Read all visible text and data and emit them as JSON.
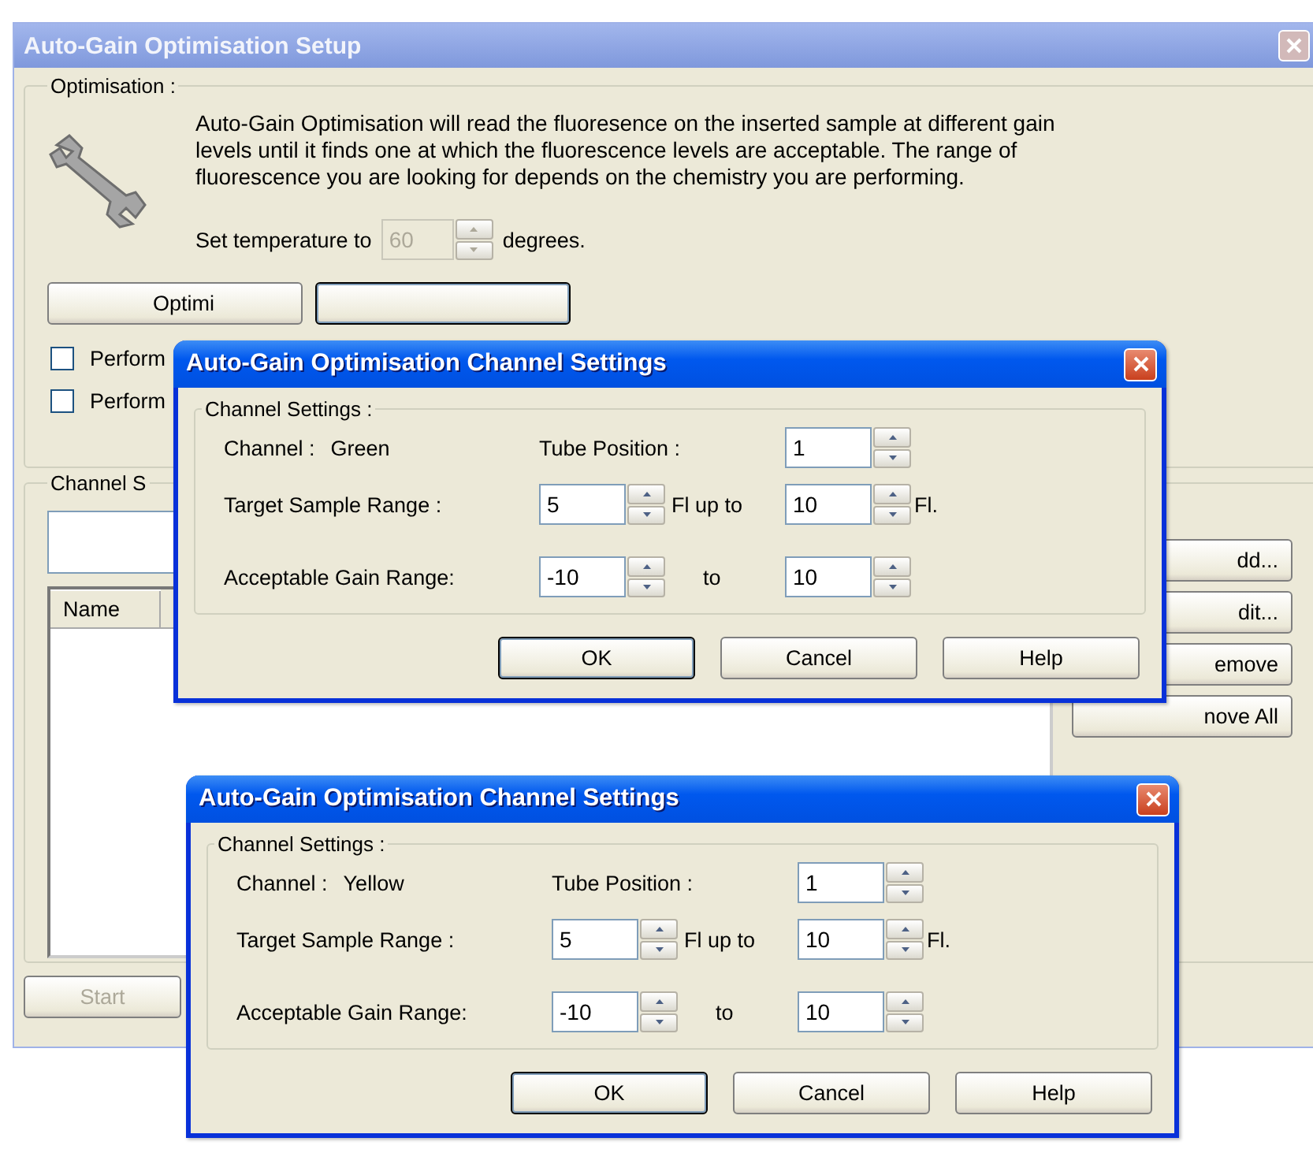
{
  "setup_window": {
    "title": "Auto-Gain Optimisation Setup",
    "optimisation": {
      "legend": "Optimisation :",
      "description": "Auto-Gain Optimisation will read the fluoresence on the inserted sample at different gain levels until it finds one at which the fluorescence levels are acceptable. The range of fluorescence you are looking for depends on the chemistry you are performing.",
      "temperature_label": "Set temperature to",
      "temperature": {
        "value": "60",
        "disabled": true
      },
      "temperature_unit": "degrees.",
      "buttons": [
        {
          "label": "Optimi"
        }
      ],
      "checkboxes": [
        {
          "label": "Perform",
          "checked": false
        },
        {
          "label": "Perform",
          "checked": false
        }
      ]
    },
    "channels": {
      "legend": "Channel S",
      "list_columns": [
        "Name"
      ],
      "side_buttons": [
        "dd...",
        "dit...",
        "emove",
        "nove All"
      ]
    },
    "start_button": {
      "label": "Start",
      "disabled": true
    }
  },
  "dialogs": [
    {
      "title": "Auto-Gain Optimisation Channel Settings",
      "legend": "Channel Settings :",
      "channel_label": "Channel :",
      "channel": "Green",
      "tube_label": "Tube Position :",
      "tube": "1",
      "target_label": "Target Sample Range :",
      "target_from": "5",
      "up_to": "Fl up to",
      "target_to": "10",
      "unit": "Fl.",
      "gain_label": "Acceptable Gain Range:",
      "gain_from": "-10",
      "gain_to_label": "to",
      "gain_to": "10",
      "buttons": [
        {
          "label": "OK",
          "default": true
        },
        {
          "label": "Cancel",
          "default": false
        },
        {
          "label": "Help",
          "default": false
        }
      ]
    },
    {
      "title": "Auto-Gain Optimisation Channel Settings",
      "legend": "Channel Settings :",
      "channel_label": "Channel :",
      "channel": "Yellow",
      "tube_label": "Tube Position :",
      "tube": "1",
      "target_label": "Target Sample Range :",
      "target_from": "5",
      "up_to": "Fl up to",
      "target_to": "10",
      "unit": "Fl.",
      "gain_label": "Acceptable Gain Range:",
      "gain_from": "-10",
      "gain_to_label": "to",
      "gain_to": "10",
      "buttons": [
        {
          "label": "OK",
          "default": true
        },
        {
          "label": "Cancel",
          "default": false
        },
        {
          "label": "Help",
          "default": false
        }
      ]
    }
  ]
}
